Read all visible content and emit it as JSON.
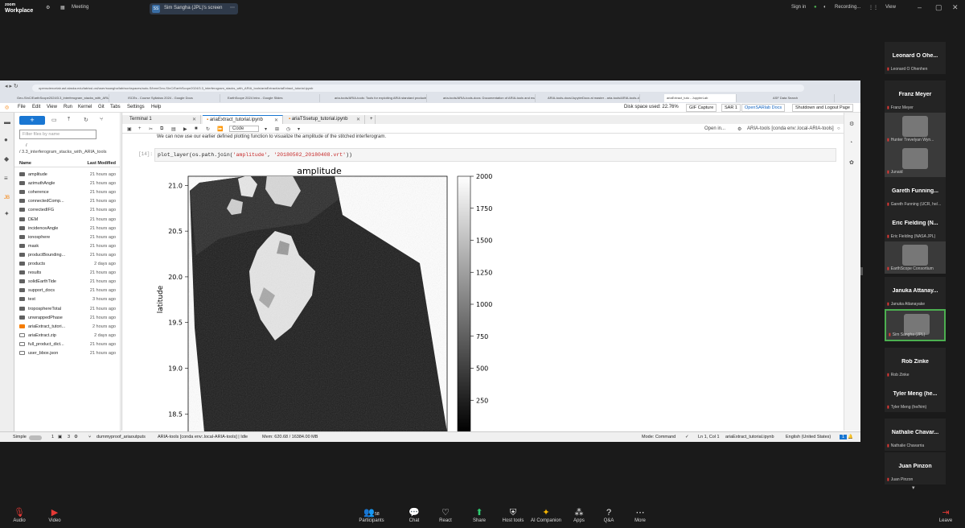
{
  "zoom": {
    "logo_line1": "zoom",
    "logo_line2": "Workplace",
    "meeting_label": "Meeting",
    "share_label": "Sim Sangha (JPL)'s screen",
    "signin": "Sign in",
    "recording": "Recording...",
    "view": "View"
  },
  "browser": {
    "url": "opensciencelab.asf.alaska.edu/lab/ssl-osl/user/ssangha/lab/workspaces/auto-S/tree/Geo-SInC/EarthScope2024/3.3_interferogram_stacks_with_ARIA_tools/ariaExtract/ariaExtract_tutorial.ipynb",
    "tabs": [
      "Geo-SInC/EarthScope2024/3.3_interferogram_stacks_with_ARIA_to...",
      "ISCEs - Course Syllabus 2024 - Google Docs",
      "EarthScope 2024 Intro - Google Slides",
      "aria-tools/ARIA-tools: Tools for exploiting ARIA standard products",
      "aria-tools/ARIA-tools-docs: Documentation of ARIA-tools and examples",
      "ARIA-tools-docs/JupyterDocs at master - aria-tools/ARIA-tools-docs",
      "ariaExtract_tuto - JupyterLab",
      "ASF Data Search"
    ]
  },
  "jupyter": {
    "menu": [
      "File",
      "Edit",
      "View",
      "Run",
      "Kernel",
      "Git",
      "Tabs",
      "Settings",
      "Help"
    ],
    "disk": "Disk space used: 22.76%",
    "gif": "GIF Capture",
    "sar": "SAR 1",
    "docs": "OpenSARlab Docs",
    "shutdown": "Shutdown and Logout Page",
    "filter_placeholder": "Filter files by name",
    "crumb1": "/",
    "crumb2": "/ 3.3_interferogram_stacks_with_ARIA_tools",
    "col_name": "Name",
    "col_modified": "Last Modified",
    "files": [
      {
        "name": "amplitude",
        "time": "21 hours ago",
        "type": "folder"
      },
      {
        "name": "azimuthAngle",
        "time": "21 hours ago",
        "type": "folder"
      },
      {
        "name": "coherence",
        "time": "21 hours ago",
        "type": "folder"
      },
      {
        "name": "connectedComp...",
        "time": "21 hours ago",
        "type": "folder"
      },
      {
        "name": "correctedIFG",
        "time": "21 hours ago",
        "type": "folder"
      },
      {
        "name": "DEM",
        "time": "21 hours ago",
        "type": "folder"
      },
      {
        "name": "incidenceAngle",
        "time": "21 hours ago",
        "type": "folder"
      },
      {
        "name": "ionosphere",
        "time": "21 hours ago",
        "type": "folder"
      },
      {
        "name": "mask",
        "time": "21 hours ago",
        "type": "folder"
      },
      {
        "name": "productBounding...",
        "time": "21 hours ago",
        "type": "folder"
      },
      {
        "name": "products",
        "time": "2 days ago",
        "type": "folder"
      },
      {
        "name": "results",
        "time": "21 hours ago",
        "type": "folder"
      },
      {
        "name": "solidEarthTide",
        "time": "21 hours ago",
        "type": "folder"
      },
      {
        "name": "support_docs",
        "time": "21 hours ago",
        "type": "folder"
      },
      {
        "name": "test",
        "time": "3 hours ago",
        "type": "folder"
      },
      {
        "name": "troposphereTotal",
        "time": "21 hours ago",
        "type": "folder"
      },
      {
        "name": "unwrappedPhase",
        "time": "21 hours ago",
        "type": "folder"
      },
      {
        "name": "ariaExtract_tutori...",
        "time": "2 hours ago",
        "type": "notebook"
      },
      {
        "name": "ariaExtract.zip",
        "time": "2 days ago",
        "type": "file"
      },
      {
        "name": "full_product_dict...",
        "time": "21 hours ago",
        "type": "file"
      },
      {
        "name": "user_bbox.json",
        "time": "21 hours ago",
        "type": "file"
      }
    ],
    "doc_tabs": [
      "Terminal 1",
      "ariaExtract_tutorial.ipynb",
      "ariaTSsetup_tutorial.ipynb"
    ],
    "cell_type": "Code",
    "open_in": "Open in...",
    "kernel": "ARIA-tools [conda env:.local-ARIA-tools]",
    "md_text": "We can now use our earlier defined plotting function to visualize the amplitude of the stitched interferogram.",
    "prompt": "[14]:",
    "code_func": "plot_layer",
    "code_mid": "(os.path.join(",
    "code_s1": "'amplitude'",
    "code_sep": ", ",
    "code_s2": "'20180502_20180408.vrt'",
    "code_end": "))",
    "status": {
      "mode_label": "Simple",
      "n1": "1",
      "n2": "3",
      "env": "dummyproof_ariaoutputs",
      "kernel": "ARIA-tools [conda env:.local-ARIA-tools] | Idle",
      "mem": "Mem: 620.68 / 16384.00 MB",
      "mode": "Mode: Command",
      "pos": "Ln 1, Col 1",
      "file": "ariaExtract_tutorial.ipynb",
      "lang": "English (United States)",
      "count": "1"
    }
  },
  "chart_data": {
    "type": "heatmap",
    "title": "amplitude",
    "ylabel": "latitude",
    "yticks": [
      21.0,
      20.5,
      20.0,
      19.5,
      19.0,
      18.5
    ],
    "ylim": [
      18.3,
      21.1
    ],
    "colorbar": {
      "ticks": [
        2000,
        1750,
        1500,
        1250,
        1000,
        750,
        500,
        250
      ],
      "range": [
        0,
        2000
      ],
      "cmap": "gray"
    }
  },
  "participants": [
    {
      "name": "Leonard O Ohe...",
      "sub": "Leonard O Ohenhen",
      "video": false
    },
    {
      "name": "Franz Meyer",
      "sub": "Franz Meyer",
      "video": false
    },
    {
      "name": "",
      "sub": "Hunter Trevelyan Wyn...",
      "video": true
    },
    {
      "name": "",
      "sub": "Junaid",
      "video": true
    },
    {
      "name": "Gareth Funning...",
      "sub": "Gareth Funning (UCR, he/...",
      "video": false
    },
    {
      "name": "Eric Fielding (N...",
      "sub": "Eric Fielding (NASA JPL)",
      "video": false
    },
    {
      "name": "",
      "sub": "EarthScope Consortium",
      "video": true
    },
    {
      "name": "Januka Attanay...",
      "sub": "Januka Attanayake",
      "video": false
    },
    {
      "name": "",
      "sub": "Sim Sangha (JPL)",
      "video": true
    },
    {
      "name": "Rob Zinke",
      "sub": "Rob Zinke",
      "video": false
    },
    {
      "name": "Tyler Meng (he...",
      "sub": "Tyler Meng (he/him)",
      "video": false
    },
    {
      "name": "Nathalie Chavar...",
      "sub": "Nathalie Chavarria",
      "video": false
    },
    {
      "name": "Juan Pinzon",
      "sub": "Juan Pinzon",
      "video": false
    }
  ],
  "bottom": {
    "audio": "Audio",
    "video": "Video",
    "participants": "Participants",
    "participants_count": "58",
    "chat": "Chat",
    "react": "React",
    "share": "Share",
    "host": "Host tools",
    "ai": "AI Companion",
    "apps": "Apps",
    "qa": "Q&A",
    "more": "More",
    "leave": "Leave"
  }
}
